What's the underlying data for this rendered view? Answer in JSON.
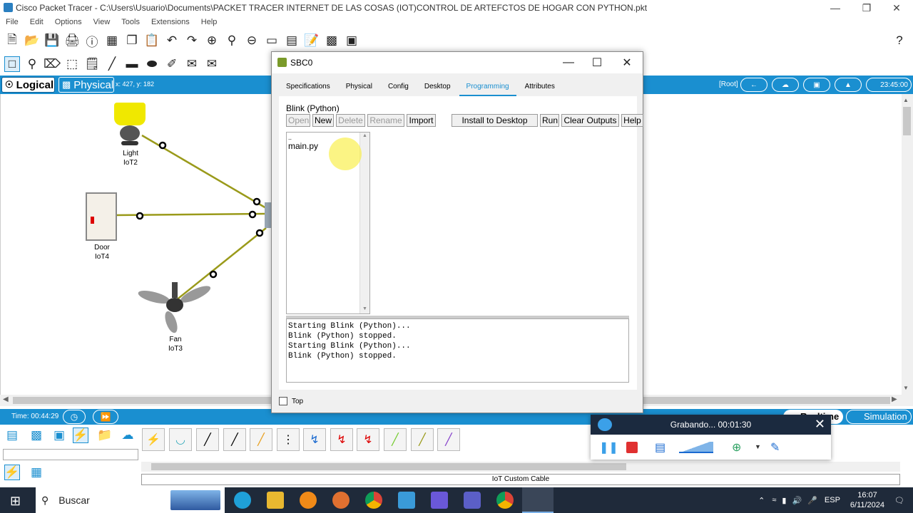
{
  "window": {
    "title": "Cisco Packet Tracer - C:\\Users\\Usuario\\Documents\\PACKET TRACER INTERNET DE LAS COSAS  (IOT)CONTROL DE ARTEFCTOS DE HOGAR CON PYTHON.pkt"
  },
  "menu": [
    "File",
    "Edit",
    "Options",
    "View",
    "Tools",
    "Extensions",
    "Help"
  ],
  "mode_bar": {
    "logical_label": "Logical",
    "physical_label": "Physical",
    "coords": "x: 427, y: 182",
    "root_label": "[Root]",
    "clock": "23:45:00"
  },
  "devices": [
    {
      "name": "Light",
      "id": "IoT2"
    },
    {
      "name": "Door",
      "id": "IoT4"
    },
    {
      "name": "Fan",
      "id": "IoT3"
    }
  ],
  "status": {
    "time": "Time: 00:44:29",
    "realtime_label": "Realtime",
    "simulation_label": "Simulation"
  },
  "cable_label": "IoT Custom Cable",
  "dialog": {
    "title": "SBC0",
    "tabs": [
      "Specifications",
      "Physical",
      "Config",
      "Desktop",
      "Programming",
      "Attributes"
    ],
    "active_tab": "Programming",
    "project_title": "Blink (Python)",
    "buttons": {
      "open": "Open",
      "new": "New",
      "delete": "Delete",
      "rename": "Rename",
      "import": "Import",
      "install": "Install to Desktop",
      "run": "Run",
      "clear": "Clear Outputs",
      "help": "Help"
    },
    "files": [
      "..",
      "main.py"
    ],
    "output_lines": [
      "Starting Blink (Python)...",
      "Blink (Python) stopped.",
      "Starting Blink (Python)...",
      "Blink (Python) stopped."
    ],
    "top_label": "Top"
  },
  "recorder": {
    "status": "Grabando... 00:01:30"
  },
  "taskbar": {
    "search": "Buscar",
    "lang": "ESP",
    "time": "16:07",
    "date": "6/11/2024"
  },
  "colors": {
    "accent": "#1a8fd0",
    "link": "#9a9a1a",
    "taskbar": "#1f2a3a"
  }
}
